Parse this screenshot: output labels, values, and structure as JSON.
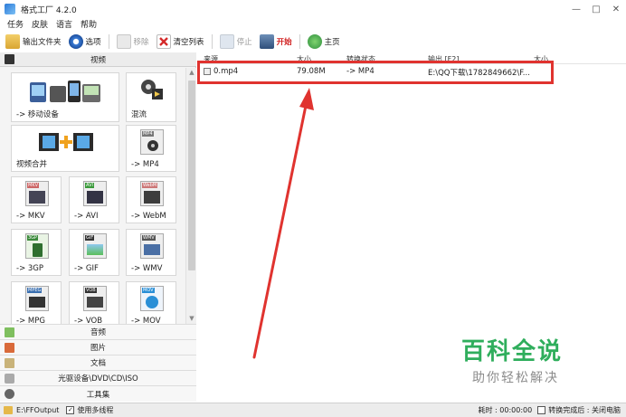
{
  "window": {
    "title": "格式工厂 4.2.0",
    "controls": [
      "—",
      "□",
      "✕"
    ]
  },
  "menu": [
    "任务",
    "皮肤",
    "语言",
    "帮助"
  ],
  "toolbar": {
    "output_folder": "输出文件夹",
    "options": "选项",
    "remove": "移除",
    "clear_list": "清空列表",
    "stop": "停止",
    "start": "开始",
    "home": "主页"
  },
  "sidebar": {
    "video_category": "视频",
    "tiles": [
      {
        "label": "-> 移动设备",
        "icon": "mobile-devices-icon"
      },
      {
        "label": "混流",
        "icon": "mux-icon"
      },
      {
        "label": "视频合并",
        "icon": "video-join-icon"
      },
      {
        "label": "-> MP4",
        "icon": "mp4-icon",
        "badge": "MP4"
      },
      {
        "label": "-> MKV",
        "icon": "mkv-icon",
        "badge": "MKV"
      },
      {
        "label": "-> AVI",
        "icon": "avi-icon",
        "badge": "AVI"
      },
      {
        "label": "-> WebM",
        "icon": "webm-icon",
        "badge": "WebM"
      },
      {
        "label": "-> 3GP",
        "icon": "3gp-icon",
        "badge": "3GP"
      },
      {
        "label": "-> GIF",
        "icon": "gif-icon",
        "badge": "GIF"
      },
      {
        "label": "-> WMV",
        "icon": "wmv-icon",
        "badge": "WMV"
      },
      {
        "label": "-> MPG",
        "icon": "mpg-icon",
        "badge": "MPEG"
      },
      {
        "label": "-> VOB",
        "icon": "vob-icon",
        "badge": "VOB"
      },
      {
        "label": "-> MOV",
        "icon": "mov-icon",
        "badge": "MOV"
      }
    ],
    "categories": [
      "音频",
      "图片",
      "文档",
      "光驱设备\\DVD\\CD\\ISO",
      "工具集"
    ]
  },
  "task_list": {
    "headers": [
      "来源",
      "大小",
      "转换状态",
      "输出 [F2]",
      "大小"
    ],
    "rows": [
      {
        "name": "0.mp4",
        "size": "79.08M",
        "status": "-> MP4",
        "output": "E:\\QQ下载\\1782849662\\F...",
        "out_size": ""
      }
    ]
  },
  "statusbar": {
    "output_path": "E:\\FFOutput",
    "multithread": "使用多线程",
    "elapsed": "耗时 : 00:00:00",
    "after_convert": "转换完成后 : 关闭电脑"
  },
  "watermark": {
    "main": "百科全说",
    "sub": "助你轻松解决"
  },
  "colors": {
    "highlight": "#e0332f",
    "watermark": "#2fae5c",
    "start": "#d02020"
  }
}
